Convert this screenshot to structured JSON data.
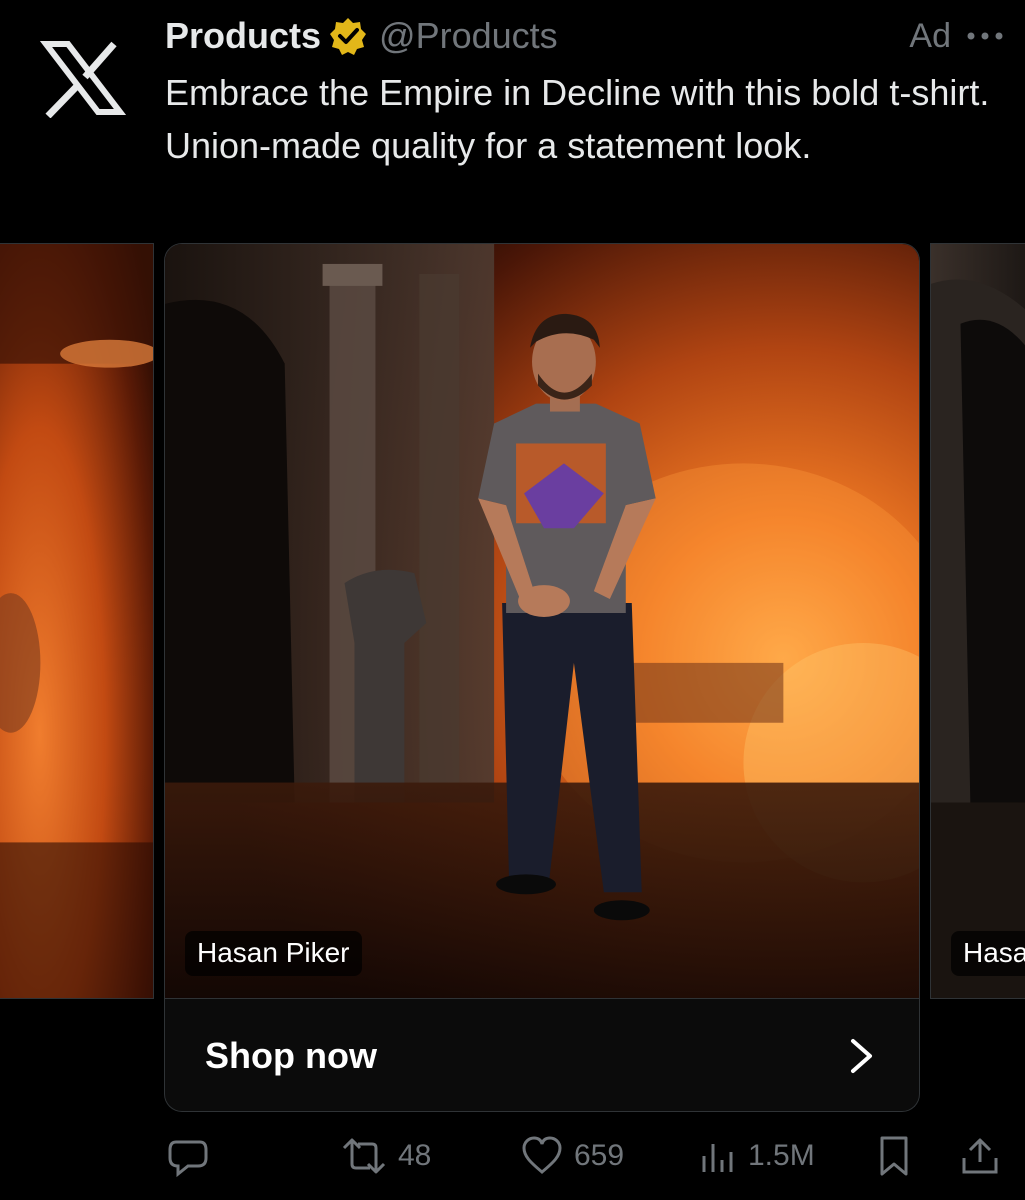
{
  "app": {
    "logo_icon": "x-logo-icon"
  },
  "post": {
    "display_name": "Products",
    "verified_icon": "verified-badge-icon",
    "verified_color": "#e2b719",
    "handle": "@Products",
    "ad_label": "Ad",
    "more_icon": "more-dots-icon",
    "text": "Embrace the Empire in Decline with this bold t-shirt. Union-made quality for a statement look."
  },
  "carousel": {
    "cards": [
      {
        "tag": ""
      },
      {
        "tag": "Hasan Piker"
      },
      {
        "tag": "Hasa"
      }
    ],
    "cta_label": "Shop now",
    "cta_icon": "chevron-right-icon"
  },
  "actions": {
    "reply": {
      "icon": "reply-icon",
      "count": ""
    },
    "repost": {
      "icon": "repost-icon",
      "count": "48"
    },
    "like": {
      "icon": "heart-icon",
      "count": "659"
    },
    "views": {
      "icon": "views-icon",
      "count": "1.5M"
    },
    "bookmark": {
      "icon": "bookmark-icon"
    },
    "share": {
      "icon": "share-icon"
    }
  },
  "colors": {
    "background": "#000000",
    "text_primary": "#e7e9ea",
    "text_secondary": "#71767b",
    "fire_orange": "#e8661a"
  }
}
